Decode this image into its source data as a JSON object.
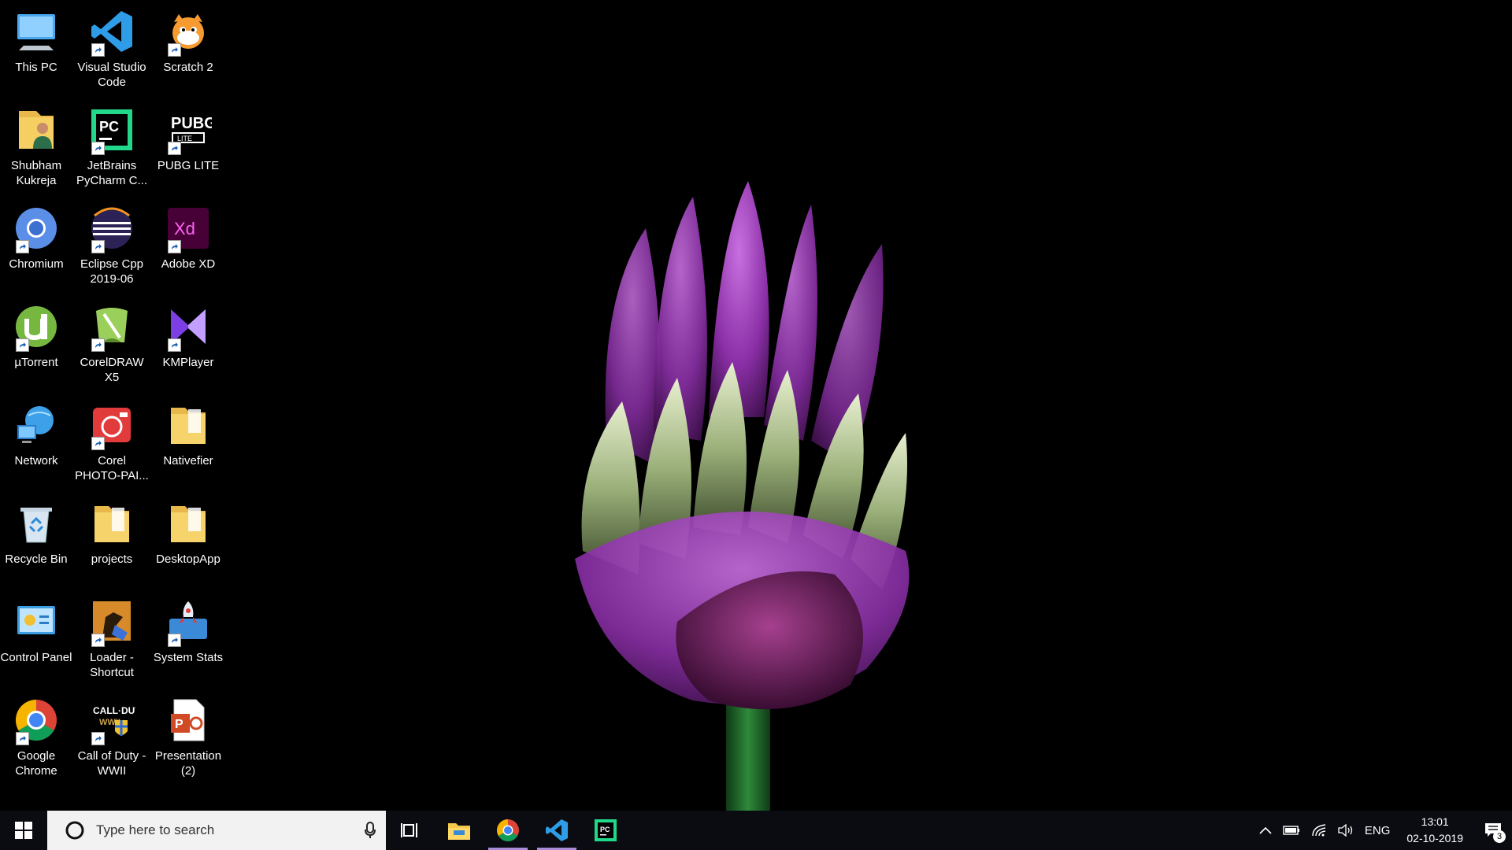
{
  "desktop_icons": [
    {
      "label": "This PC",
      "icon": "this-pc-icon",
      "shortcut": false
    },
    {
      "label": "Visual Studio\nCode",
      "icon": "vscode-icon",
      "shortcut": true
    },
    {
      "label": "Scratch 2",
      "icon": "scratch-icon",
      "shortcut": true
    },
    {
      "label": "Shubham\nKukreja",
      "icon": "user-folder-icon",
      "shortcut": false
    },
    {
      "label": "JetBrains\nPyCharm C...",
      "icon": "pycharm-icon",
      "shortcut": true
    },
    {
      "label": "PUBG LITE",
      "icon": "pubg-icon",
      "shortcut": true
    },
    {
      "label": "Chromium",
      "icon": "chromium-icon",
      "shortcut": true
    },
    {
      "label": "Eclipse Cpp\n2019-06",
      "icon": "eclipse-icon",
      "shortcut": true
    },
    {
      "label": "Adobe XD",
      "icon": "adobe-xd-icon",
      "shortcut": true
    },
    {
      "label": "µTorrent",
      "icon": "utorrent-icon",
      "shortcut": true
    },
    {
      "label": "CorelDRAW\nX5",
      "icon": "coreldraw-icon",
      "shortcut": true
    },
    {
      "label": "KMPlayer",
      "icon": "kmplayer-icon",
      "shortcut": true
    },
    {
      "label": "Network",
      "icon": "network-icon",
      "shortcut": false
    },
    {
      "label": "Corel\nPHOTO-PAI...",
      "icon": "corel-photopaint-icon",
      "shortcut": true
    },
    {
      "label": "Nativefier",
      "icon": "folder-icon",
      "shortcut": false
    },
    {
      "label": "Recycle Bin",
      "icon": "recycle-bin-icon",
      "shortcut": false
    },
    {
      "label": "projects",
      "icon": "folder-icon",
      "shortcut": false
    },
    {
      "label": "DesktopApp",
      "icon": "folder-icon",
      "shortcut": false
    },
    {
      "label": "Control Panel",
      "icon": "control-panel-icon",
      "shortcut": false
    },
    {
      "label": "Loader -\nShortcut",
      "icon": "loader-icon",
      "shortcut": true
    },
    {
      "label": "System Stats",
      "icon": "system-stats-icon",
      "shortcut": true
    },
    {
      "label": "Google\nChrome",
      "icon": "chrome-icon",
      "shortcut": true
    },
    {
      "label": "Call of Duty -\nWWII",
      "icon": "call-of-duty-icon",
      "shortcut": true
    },
    {
      "label": "Presentation\n(2)",
      "icon": "powerpoint-icon",
      "shortcut": false
    }
  ],
  "taskbar": {
    "search_placeholder": "Type here to search",
    "pinned_apps": [
      {
        "name": "task-view",
        "icon": "task-view-icon",
        "active": false
      },
      {
        "name": "file-explorer",
        "icon": "file-explorer-icon",
        "active": false
      },
      {
        "name": "google-chrome",
        "icon": "chrome-icon",
        "active": true
      },
      {
        "name": "visual-studio-code",
        "icon": "vscode-icon",
        "active": true
      },
      {
        "name": "pycharm",
        "icon": "pycharm-icon",
        "active": false
      }
    ],
    "tray": {
      "language": "ENG",
      "time": "13:01",
      "date": "02-10-2019",
      "notification_count": "3"
    }
  },
  "colors": {
    "taskbar_bg": "#0a0c11",
    "active_indicator": "#a98cd8",
    "flower_purple": "#9b3fb5"
  }
}
